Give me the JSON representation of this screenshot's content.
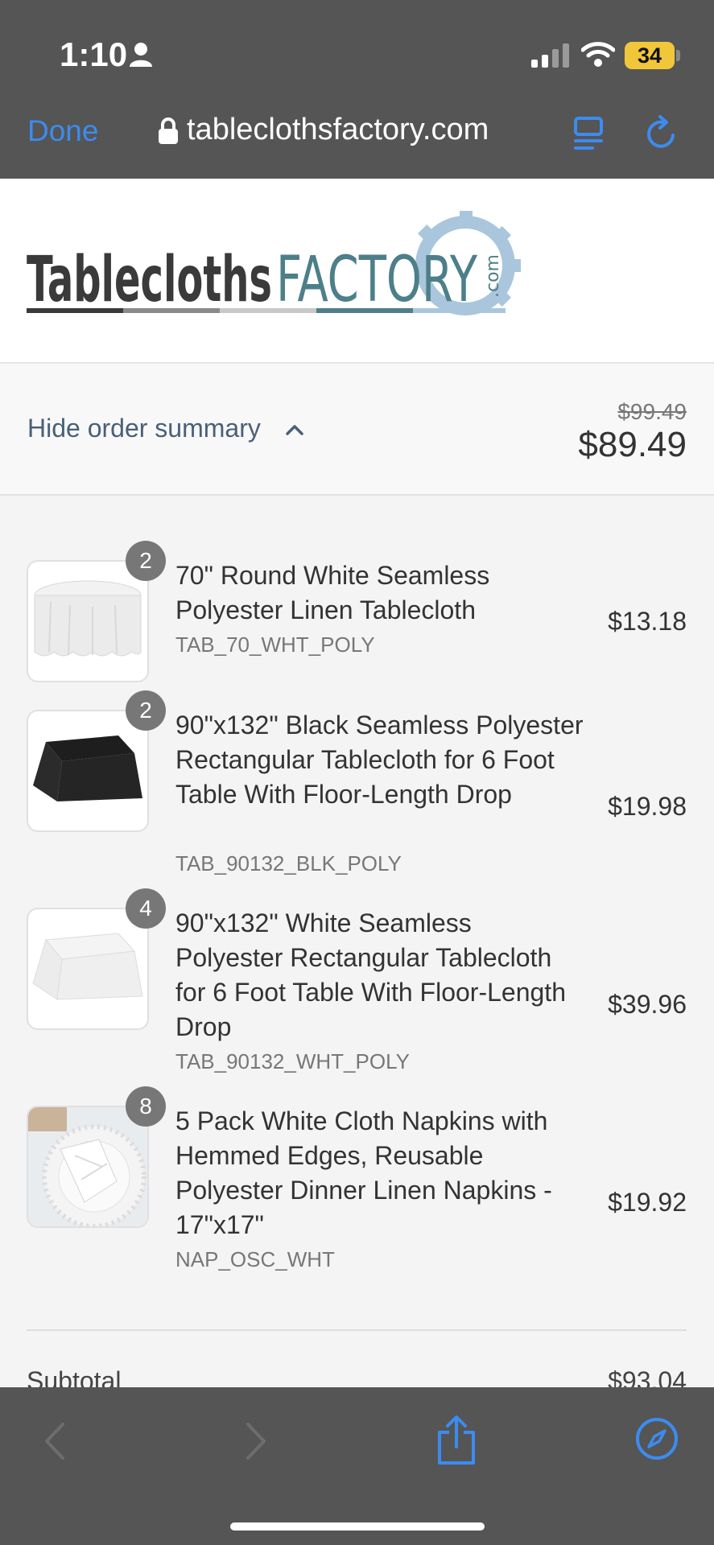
{
  "status_bar": {
    "time": "1:10",
    "battery": "34"
  },
  "browser": {
    "done_label": "Done",
    "url": "tableclothsfactory.com"
  },
  "logo": {
    "part1": "Tablecloths",
    "part2": "FACTORY",
    "suffix": ".com"
  },
  "summary": {
    "toggle_label": "Hide order summary",
    "original_price": "$99.49",
    "total_price": "$89.49"
  },
  "items": [
    {
      "quantity": "2",
      "title": "70\" Round White Seamless Polyester Linen Tablecloth",
      "sku": "TAB_70_WHT_POLY",
      "price": "$13.18"
    },
    {
      "quantity": "2",
      "title": "90\"x132\" Black Seamless Polyester Rectangular Tablecloth for 6 Foot Table With Floor-Length Drop",
      "sku": "TAB_90132_BLK_POLY",
      "price": "$19.98"
    },
    {
      "quantity": "4",
      "title": "90\"x132\" White Seamless Polyester Rectangular Tablecloth for 6 Foot Table With Floor-Length Drop",
      "sku": "TAB_90132_WHT_POLY",
      "price": "$39.96"
    },
    {
      "quantity": "8",
      "title": "5 Pack White Cloth Napkins with Hemmed Edges, Reusable Polyester Dinner Linen Napkins - 17\"x17\"",
      "sku": "NAP_OSC_WHT",
      "price": "$19.92"
    }
  ],
  "totals": {
    "subtotal_label": "Subtotal",
    "subtotal_value": "$93.04"
  },
  "colors": {
    "chrome": "#555555",
    "link_blue": "#3c8cf0",
    "logo_dark": "#3a3a3a",
    "logo_teal": "#4d7f8a",
    "logo_gear": "#a9c6dc"
  },
  "icons": [
    "person-icon",
    "signal-icon",
    "wifi-icon",
    "lock-icon",
    "reader-icon",
    "reload-icon",
    "chevron-up-icon",
    "back-icon",
    "forward-icon",
    "share-icon",
    "compass-icon"
  ]
}
